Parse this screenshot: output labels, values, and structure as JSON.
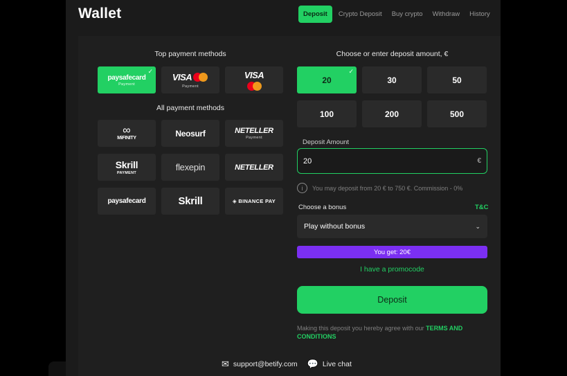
{
  "header": {
    "title": "Wallet"
  },
  "tabs": [
    {
      "label": "Deposit",
      "active": true
    },
    {
      "label": "Crypto Deposit"
    },
    {
      "label": "Buy crypto"
    },
    {
      "label": "Withdraw"
    },
    {
      "label": "History"
    }
  ],
  "top_methods": {
    "title": "Top payment methods",
    "items": [
      {
        "logo": "paysafecard",
        "sub": "Payment",
        "selected": true
      },
      {
        "logo": "VISA",
        "sub": "Payment",
        "icon": "mastercard-icon"
      },
      {
        "logo": "VISA",
        "sub": "",
        "icon": "mastercard-icon"
      }
    ]
  },
  "all_methods": {
    "title": "All payment methods",
    "items": [
      {
        "logo": "MiFINITY",
        "icon": "infinity-icon"
      },
      {
        "logo": "Neosurf"
      },
      {
        "logo": "NETELLER",
        "sub": "Payment"
      },
      {
        "logo": "Skrill",
        "sub": "PAYMENT"
      },
      {
        "logo": "flexepin"
      },
      {
        "logo": "NETELLER"
      },
      {
        "logo": "paysafecard"
      },
      {
        "logo": "Skrill"
      },
      {
        "logo": "BINANCE PAY",
        "icon": "binance-icon"
      }
    ]
  },
  "amounts": {
    "title": "Choose or enter deposit amount, €",
    "options": [
      "20",
      "30",
      "50",
      "100",
      "200",
      "500"
    ],
    "selected": "20"
  },
  "deposit_field": {
    "label": "Deposit Amount",
    "value": "20",
    "currency": "€"
  },
  "limits_text": "You may deposit from 20 € to 750 €. Commission - 0%",
  "bonus": {
    "label": "Choose a bonus",
    "tc": "T&C",
    "selected": "Play without bonus"
  },
  "you_get": "You get: 20€",
  "promo": "I have a promocode",
  "deposit_button": "Deposit",
  "terms": {
    "text": "Making this deposit you hereby agree with our",
    "link": "TERMS AND CONDITIONS"
  },
  "footer": {
    "email": "support@betify.com",
    "chat": "Live chat"
  },
  "colors": {
    "accent": "#22d063",
    "purple": "#7b2ff2",
    "panel": "#1f1f1f"
  }
}
